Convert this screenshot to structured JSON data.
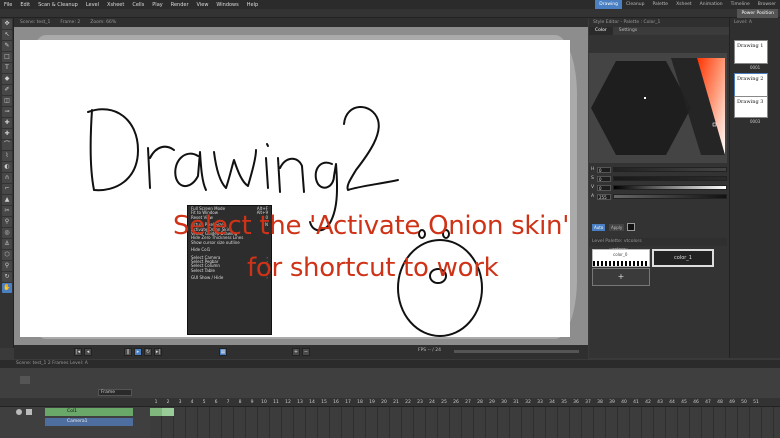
{
  "menubar": {
    "items": [
      "File",
      "Edit",
      "Scan & Cleanup",
      "Level",
      "Xsheet",
      "Cells",
      "Play",
      "Render",
      "View",
      "Windows",
      "Help"
    ],
    "rooms": [
      "Drawing",
      "Cleanup",
      "Palette",
      "Xsheet",
      "Animation",
      "Timeline",
      "Browser"
    ],
    "active_room": "Drawing",
    "power_position": "Power Position"
  },
  "viewer": {
    "header": [
      "Scene: test_1",
      "Frame: 2",
      "Zoom: 66%"
    ],
    "fps_label": "FPS -- / 24"
  },
  "context_menu": {
    "items": [
      {
        "label": "Full Screen Mode",
        "shortcut": "Alt+F"
      },
      {
        "label": "Fit to Window",
        "shortcut": "Alt+9"
      },
      {
        "label": "Reset View",
        "shortcut": "0"
      },
      {
        "label": "Actual Pixel Size",
        "shortcut": "N"
      },
      {
        "label": "Activate Onion Skin",
        "shortcut": ""
      },
      {
        "label": "Vector Guided Drawing",
        "shortcut": "›"
      },
      {
        "label": "Hide Zero Thickness Lines",
        "shortcut": ""
      },
      {
        "label": "Show cursor size outline",
        "shortcut": ""
      },
      {
        "label": "Hide Col1",
        "shortcut": ""
      },
      {
        "label": "Select Camera",
        "shortcut": "›"
      },
      {
        "label": "Select Pegbar",
        "shortcut": "›"
      },
      {
        "label": "Select Column",
        "shortcut": "›"
      },
      {
        "label": "Select Table",
        "shortcut": ""
      },
      {
        "label": "GUI Show / Hide",
        "shortcut": "›"
      }
    ]
  },
  "overlay": {
    "line1": "Select the 'Activate Onion skin'",
    "line2": "for shortcut to work"
  },
  "style_panel": {
    "header": "Style Editor - Palette : Color_1",
    "tabs": [
      "Color",
      "Settings"
    ],
    "sliders": [
      {
        "name": "H",
        "value": "0"
      },
      {
        "name": "S",
        "value": "0"
      },
      {
        "name": "V",
        "value": "0"
      },
      {
        "name": "A",
        "value": "255"
      }
    ],
    "auto_label": "Auto",
    "apply_label": "Apply",
    "palette_header": "Level Palette: vtcolors",
    "palette_name": "colors",
    "swatch1_label": "color_0",
    "swatch2_label": "color_1",
    "add_label": "+"
  },
  "level_panel": {
    "header": "Level: A",
    "thumbs": [
      {
        "caption": "Drawing 1",
        "frame": "0001"
      },
      {
        "caption": "Drawing 2",
        "frame": "0002"
      },
      {
        "caption": "Drawing 3",
        "frame": "0003"
      }
    ]
  },
  "xsheet": {
    "header": "Scene: test_1    2 Frames  Level: A",
    "frame_dropdown": "Frame",
    "track1": "Col1",
    "track2": "Camera1",
    "frames": [
      "1",
      "2",
      "3",
      "4",
      "5",
      "6",
      "7",
      "8",
      "9",
      "10",
      "11",
      "12",
      "13",
      "14",
      "15",
      "16",
      "17",
      "18",
      "19",
      "20",
      "21",
      "22",
      "23",
      "24",
      "25",
      "26",
      "27",
      "28",
      "29",
      "30",
      "31",
      "32",
      "33",
      "34",
      "35",
      "36",
      "37",
      "38",
      "39",
      "40",
      "41",
      "42",
      "43",
      "44",
      "45",
      "46",
      "47",
      "48",
      "49",
      "50",
      "51"
    ]
  },
  "colors": {
    "accent": "#4a7fc1",
    "overlay_text": "#cf3317",
    "track_green": "#6aa86a",
    "track_blue": "#4d6e9e"
  }
}
